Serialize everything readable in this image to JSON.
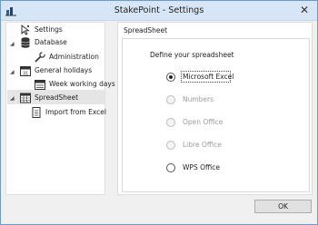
{
  "window": {
    "title": "StakePoint - Settings",
    "close_glyph": "✕"
  },
  "tree": {
    "items": [
      {
        "label": "Settings",
        "icon": "cursor-icon"
      },
      {
        "label": "Database",
        "icon": "database-icon",
        "expanded": true
      },
      {
        "label": "Administration",
        "icon": "wrench-icon"
      },
      {
        "label": "General holidays",
        "icon": "calendar-icon",
        "expanded": true
      },
      {
        "label": "Week working days",
        "icon": "calendar-week-icon"
      },
      {
        "label": "SpreadSheet",
        "icon": "spreadsheet-icon",
        "expanded": true,
        "selected": true
      },
      {
        "label": "Import from Excel",
        "icon": "import-icon"
      }
    ],
    "expander_glyph": "◢"
  },
  "panel": {
    "header": "SpreadSheet",
    "define_label": "Define your spreadsheet",
    "options": [
      {
        "label": "Microsoft Excel",
        "checked": true,
        "enabled": true
      },
      {
        "label": "Numbers",
        "checked": false,
        "enabled": false
      },
      {
        "label": "Open Office",
        "checked": false,
        "enabled": false
      },
      {
        "label": "Libre Office",
        "checked": false,
        "enabled": false
      },
      {
        "label": "WPS Office",
        "checked": false,
        "enabled": true
      }
    ]
  },
  "footer": {
    "ok_label": "OK"
  },
  "colors": {
    "titlebar": "#d7e6f6",
    "selected_row": "#e5e5e5",
    "window_bg": "#f0f0f0"
  }
}
